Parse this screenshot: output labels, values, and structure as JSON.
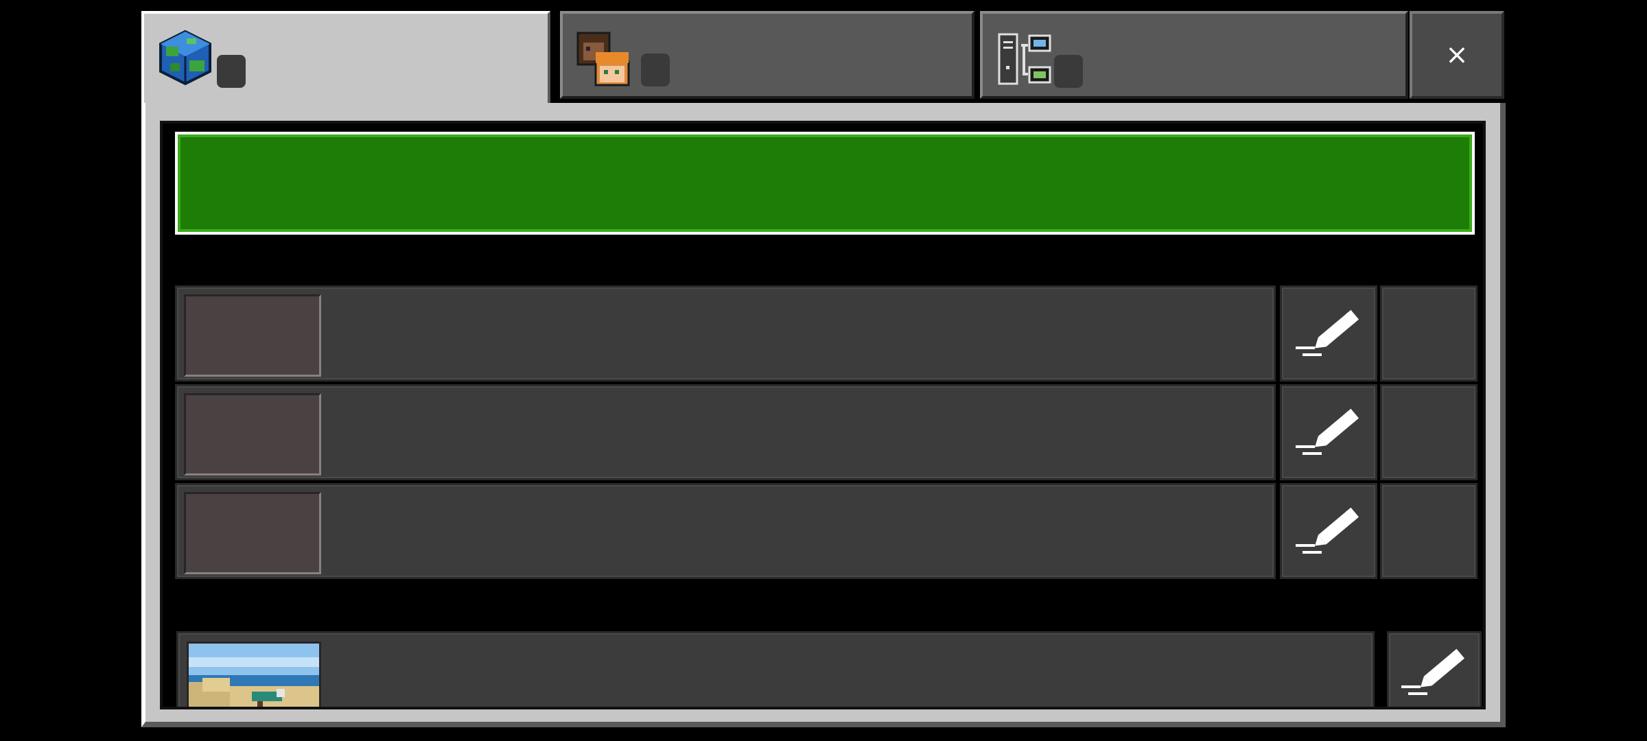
{
  "window": {
    "tabs": [
      {
        "icon": "globe-world-icon",
        "active": true,
        "badge": ""
      },
      {
        "icon": "players-faces-icon",
        "active": false,
        "badge": ""
      },
      {
        "icon": "server-network-icon",
        "active": false,
        "badge": ""
      }
    ],
    "close": {
      "icon": "close-icon",
      "label": "×"
    }
  },
  "main": {
    "primary_button": {
      "label": ""
    },
    "world_rows": [
      {
        "title": "",
        "thumbnail": "empty",
        "edit_icon": "pencil-edit-icon"
      },
      {
        "title": "",
        "thumbnail": "empty",
        "edit_icon": "pencil-edit-icon"
      },
      {
        "title": "",
        "thumbnail": "empty",
        "edit_icon": "pencil-edit-icon"
      }
    ],
    "last_row": {
      "title": "",
      "thumbnail": "beach-scene",
      "edit_icon": "pencil-edit-icon"
    }
  },
  "colors": {
    "accent_green": "#1e7d06",
    "panel": "#c6c6c6",
    "row": "#3c3c3c"
  }
}
